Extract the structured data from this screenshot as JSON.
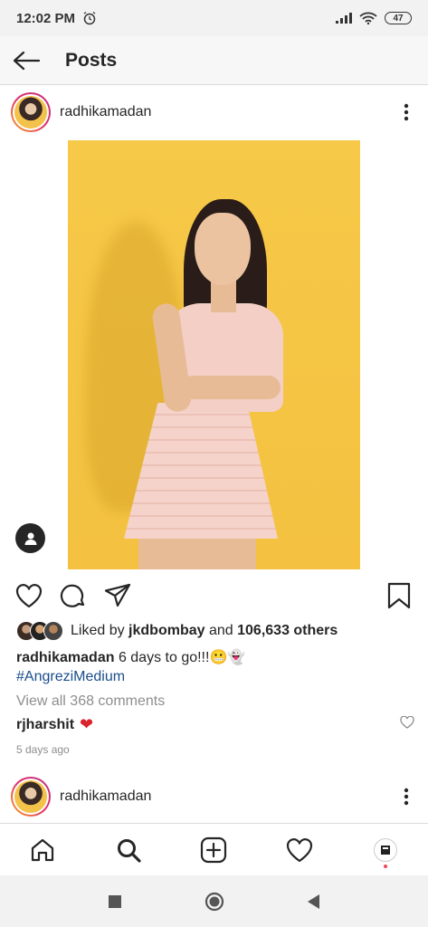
{
  "status_bar": {
    "time": "12:02 PM",
    "battery": "47"
  },
  "header": {
    "title": "Posts"
  },
  "post": {
    "username": "radhikamadan",
    "likes": {
      "prefix": "Liked by",
      "first_liker": "jkdbombay",
      "connector": "and",
      "others": "106,633 others"
    },
    "caption": {
      "username": "radhikamadan",
      "text": "6 days to go!!!😬👻",
      "hashtag": "#AngreziMedium"
    },
    "view_comments": "View all 368 comments",
    "comment": {
      "username": "rjharshit",
      "emoji": "❤"
    },
    "time_ago": "5 days ago"
  },
  "next_post": {
    "username": "radhikamadan"
  },
  "colors": {
    "accent": "#1a4d8c",
    "heart": "#d9232d",
    "image_bg": "#f6c948"
  },
  "icons": {
    "back": "arrow-left-icon",
    "more": "more-vertical-icon",
    "like": "heart-icon",
    "comment": "comment-icon",
    "share": "paper-plane-icon",
    "save": "bookmark-icon",
    "home": "home-icon",
    "search": "search-icon",
    "add": "add-post-icon",
    "activity": "heart-icon",
    "profile": "profile-avatar-icon"
  }
}
